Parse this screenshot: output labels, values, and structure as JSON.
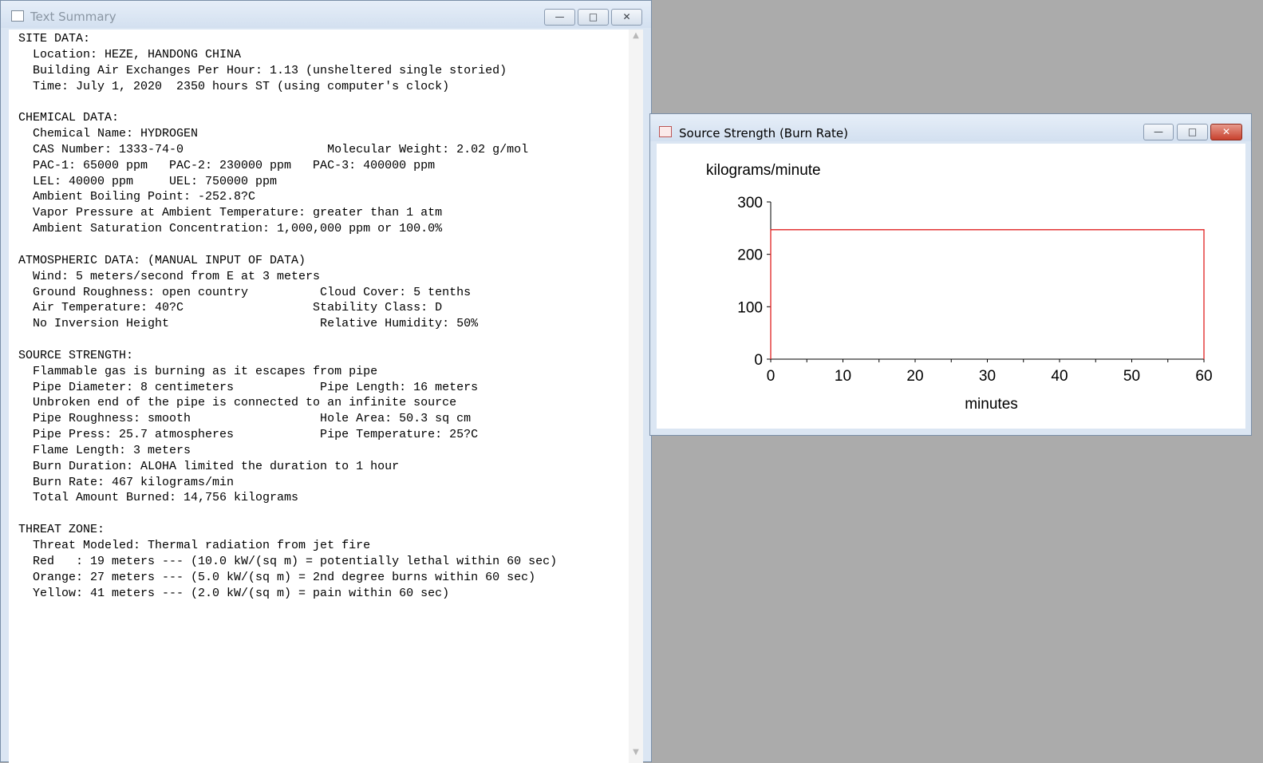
{
  "text_summary": {
    "title": "Text Summary",
    "lines": [
      "SITE DATA:",
      "  Location: HEZE, HANDONG CHINA",
      "  Building Air Exchanges Per Hour: 1.13 (unsheltered single storied)",
      "  Time: July 1, 2020  2350 hours ST (using computer's clock)",
      "",
      "CHEMICAL DATA:",
      "  Chemical Name: HYDROGEN",
      "  CAS Number: 1333-74-0                    Molecular Weight: 2.02 g/mol",
      "  PAC-1: 65000 ppm   PAC-2: 230000 ppm   PAC-3: 400000 ppm",
      "  LEL: 40000 ppm     UEL: 750000 ppm",
      "  Ambient Boiling Point: -252.8?C",
      "  Vapor Pressure at Ambient Temperature: greater than 1 atm",
      "  Ambient Saturation Concentration: 1,000,000 ppm or 100.0%",
      "",
      "ATMOSPHERIC DATA: (MANUAL INPUT OF DATA)",
      "  Wind: 5 meters/second from E at 3 meters",
      "  Ground Roughness: open country          Cloud Cover: 5 tenths",
      "  Air Temperature: 40?C                  Stability Class: D",
      "  No Inversion Height                     Relative Humidity: 50%",
      "",
      "SOURCE STRENGTH:",
      "  Flammable gas is burning as it escapes from pipe",
      "  Pipe Diameter: 8 centimeters            Pipe Length: 16 meters",
      "  Unbroken end of the pipe is connected to an infinite source",
      "  Pipe Roughness: smooth                  Hole Area: 50.3 sq cm",
      "  Pipe Press: 25.7 atmospheres            Pipe Temperature: 25?C",
      "  Flame Length: 3 meters",
      "  Burn Duration: ALOHA limited the duration to 1 hour",
      "  Burn Rate: 467 kilograms/min",
      "  Total Amount Burned: 14,756 kilograms",
      "",
      "THREAT ZONE:",
      "  Threat Modeled: Thermal radiation from jet fire",
      "  Red   : 19 meters --- (10.0 kW/(sq m) = potentially lethal within 60 sec)",
      "  Orange: 27 meters --- (5.0 kW/(sq m) = 2nd degree burns within 60 sec)",
      "  Yellow: 41 meters --- (2.0 kW/(sq m) = pain within 60 sec)"
    ]
  },
  "source_strength": {
    "title": "Source Strength (Burn Rate)"
  },
  "chart_data": {
    "type": "line",
    "ylabel": "kilograms/minute",
    "xlabel": "minutes",
    "xlim": [
      0,
      60
    ],
    "ylim": [
      0,
      300
    ],
    "xticks": [
      0,
      10,
      20,
      30,
      40,
      50,
      60
    ],
    "yticks": [
      0,
      100,
      200,
      300
    ],
    "series": [
      {
        "color": "#e02020",
        "x": [
          0,
          0,
          60,
          60
        ],
        "y": [
          0,
          247,
          247,
          0
        ]
      }
    ]
  }
}
